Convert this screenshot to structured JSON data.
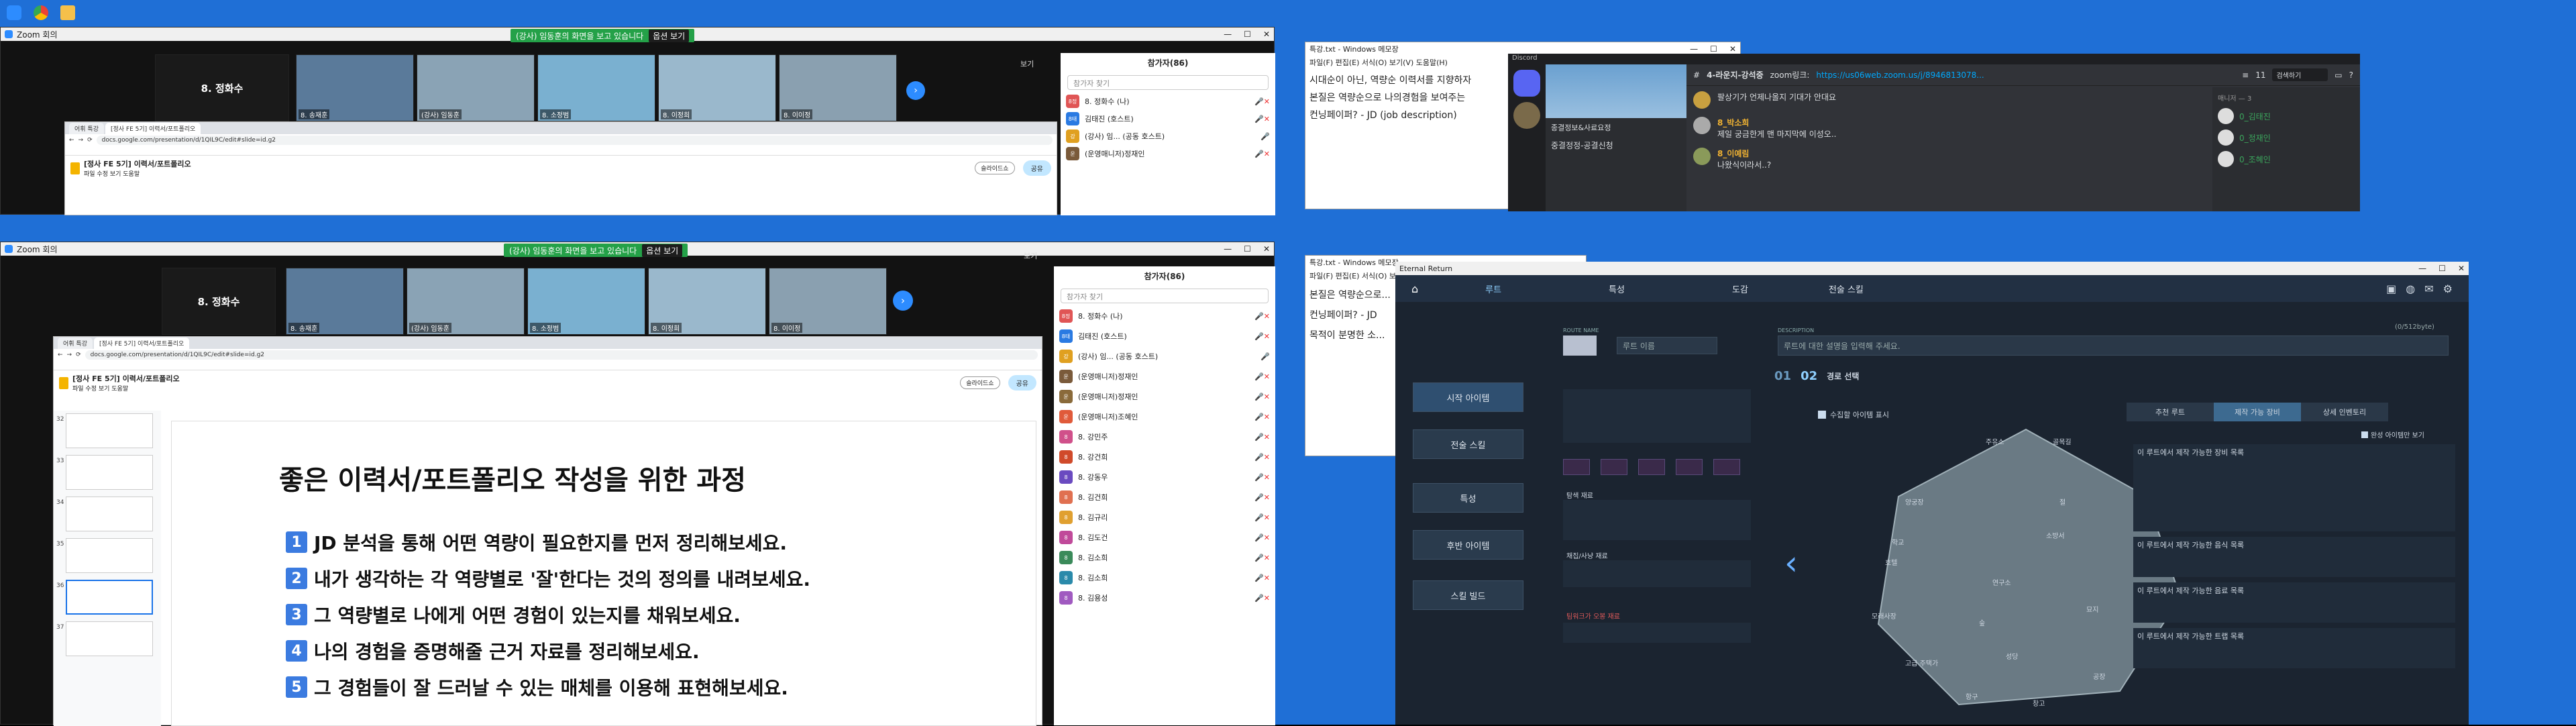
{
  "colors": {
    "zoom_green": "#24a148",
    "slides_blue": "#3b7be0",
    "desktop": "#1f6fd6"
  },
  "desktop_icons": [
    "zoom-icon",
    "chrome-icon",
    "folder-icon"
  ],
  "zoom_top": {
    "title": "Zoom 회의",
    "banner_text": "(강사) 임동훈의 화면을 보고 있습니다",
    "banner_button": "옵션 보기",
    "view_label": "보기",
    "speaker": "8. 정화수",
    "tiles": [
      "8. 송재훈",
      "(강사) 임동훈",
      "8. 소정범",
      "8. 이정희",
      "8. 이이정"
    ],
    "participants_header": "참가자(86)",
    "search_placeholder": "참가자 찾기",
    "participants": [
      {
        "badge": "8정",
        "name": "8. 정화수 (나)",
        "color": "#e05555"
      },
      {
        "badge": "8태",
        "name": "김태진 (호스트)",
        "color": "#2a7ae2"
      },
      {
        "badge": "강",
        "name": "(강사) 임... (공동 호스트)",
        "color": "#e0a020"
      },
      {
        "badge": "운",
        "name": "(운영매니저)정재인",
        "color": "#7a5a3a"
      }
    ]
  },
  "zoom_bottom": {
    "title": "Zoom 회의",
    "banner_text": "(강사) 임동훈의 화면을 보고 있습니다",
    "banner_button": "옵션 보기",
    "view_label": "보기",
    "speaker": "8. 정화수",
    "tiles": [
      "8. 송재훈",
      "(강사) 임동훈",
      "8. 소정범",
      "8. 이정희",
      "8. 이이정"
    ],
    "participants_header": "참가자(86)",
    "search_placeholder": "참가자 찾기",
    "participants": [
      {
        "badge": "8정",
        "name": "8. 정화수 (나)",
        "color": "#e05555"
      },
      {
        "badge": "8태",
        "name": "김태진 (호스트)",
        "color": "#2a7ae2"
      },
      {
        "badge": "강",
        "name": "(강사) 임... (공동 호스트)",
        "color": "#e0a020"
      },
      {
        "badge": "운",
        "name": "(운영매니저)정재인",
        "color": "#7a5a3a"
      },
      {
        "badge": "운",
        "name": "(운영매니저)정재인",
        "color": "#8a6a3a"
      },
      {
        "badge": "운",
        "name": "(운영매니저)조혜인",
        "color": "#e05a3a"
      },
      {
        "badge": "8",
        "name": "8. 강민주",
        "color": "#d0508a"
      },
      {
        "badge": "8",
        "name": "8. 강건희",
        "color": "#d04a2a"
      },
      {
        "badge": "8",
        "name": "8. 강동우",
        "color": "#6a4ac0"
      },
      {
        "badge": "8",
        "name": "8. 김건희",
        "color": "#e07050"
      },
      {
        "badge": "8",
        "name": "8. 김규리",
        "color": "#e0a030"
      },
      {
        "badge": "8",
        "name": "8. 김도건",
        "color": "#c04a9a"
      },
      {
        "badge": "8",
        "name": "8. 김소희",
        "color": "#3a8a5a"
      },
      {
        "badge": "8",
        "name": "8. 김소희",
        "color": "#2a8aaa"
      },
      {
        "badge": "8",
        "name": "8. 김용성",
        "color": "#a05ac0"
      }
    ]
  },
  "chrome_top": {
    "tab1": "어휘 특강",
    "tab2": "[정사 FE 5기] 이력서/포트폴리오",
    "url": "docs.google.com/presentation/d/1QIL9C/edit#slide=id.g2",
    "doc_title": "[정사 FE 5기] 이력서/포트폴리오",
    "menu": "파일  수정  보기  도움말",
    "share": "공유",
    "slideshow": "슬라이드쇼"
  },
  "chrome_bottom": {
    "tab1": "어휘 특강",
    "tab2": "[정사 FE 5기] 이력서/포트폴리오",
    "url": "docs.google.com/presentation/d/1QIL9C/edit#slide=id.g2",
    "doc_title": "[정사 FE 5기] 이력서/포트폴리오",
    "menu": "파일  수정  보기  도움말",
    "share": "공유",
    "slideshow": "슬라이드쇼",
    "thumb_numbers": [
      "32",
      "33",
      "34",
      "35",
      "36",
      "37"
    ]
  },
  "slide": {
    "title": "좋은 이력서/포트폴리오 작성을 위한 과정",
    "steps": [
      {
        "n": "1",
        "text": "JD 분석을 통해 어떤 역량이 필요한지를 먼저 정리해보세요."
      },
      {
        "n": "2",
        "text": "내가 생각하는 각 역량별로 '잘'한다는 것의 정의를 내려보세요."
      },
      {
        "n": "3",
        "text": "그 역량별로 나에게 어떤 경험이 있는지를 채워보세요."
      },
      {
        "n": "4",
        "text": "나의 경험을 증명해줄 근거 자료를 정리해보세요."
      },
      {
        "n": "5",
        "text": "그 경험들이 잘 드러날 수 있는 매체를 이용해 표현해보세요."
      }
    ]
  },
  "notepad_top": {
    "title": "특강.txt - Windows 메모장",
    "menu": "파일(F)  편집(E)  서식(O)  보기(V)  도움말(H)",
    "lines": [
      "시대순이 아닌, 역량순 이력서를 지향하자",
      "본질은 역량순으로 나의경험을 보여주는",
      "컨닝페이퍼? - JD (job description)"
    ]
  },
  "notepad_bottom": {
    "title": "특강.txt - Windows 메모장",
    "menu": "파일(F)  편집(E)  서식(O)  보기(V)  도움말(H)",
    "lines": [
      "본질은 역량순으로...",
      "컨닝페이퍼? - JD",
      "목적이 분명한 소..."
    ]
  },
  "discord": {
    "title": "Discord",
    "channel": "4-라운지-강석중",
    "server": "종결정보&사료요정",
    "channel_item": "중결정정-공결신청",
    "link_prefix": "zoom링크:",
    "link": "https://us06web.zoom.us/j/8946813078...",
    "member_count": "11",
    "search": "검색하기",
    "messages": [
      {
        "author": "",
        "text": "팔상기가 언제나올지 기대가 안대요"
      },
      {
        "author": "8_박소희",
        "text": "제일 궁금한게 맨 마지막에 이성오.."
      },
      {
        "author": "8_이예림",
        "text": "나왔식이라서..?"
      }
    ],
    "members_header": "매니저 — 3",
    "members": [
      "0_김태진",
      "0_정재인",
      "0_조혜인"
    ]
  },
  "game": {
    "title": "Eternal Return",
    "tabs": [
      "루트",
      "특성",
      "도감",
      "전술 스킬"
    ],
    "left_buttons": [
      "시작 아이템",
      "전술 스킬",
      "특성",
      "후반 아이템",
      "스킬 빌드"
    ],
    "route_name_label": "ROUTE NAME",
    "route_name_placeholder": "루트 이름",
    "description_label": "DESCRIPTION",
    "description_placeholder": "루트에 대한 설명을 입력해 주세요.",
    "char_counter": "(0/512byte)",
    "step1": "01",
    "step2": "02",
    "step2_label": "경로 선택",
    "collect_toggle": "수집할 아이템 표시",
    "right_tabs": [
      "추천 루트",
      "제작 가능 장비",
      "상세 인벤토리"
    ],
    "complete_toggle": "완성 아이템만 보기",
    "sections": [
      "이 루트에서 제작 가능한 장비 목록",
      "이 루트에서 제작 가능한 음식 목록",
      "이 루트에서 제작 가능한 음료 목록",
      "이 루트에서 제작 가능한 트랩 목록"
    ],
    "map_labels": [
      "주유소",
      "골목길",
      "양궁장",
      "절",
      "호텔",
      "모래사장",
      "연구소",
      "묘지",
      "숲",
      "고급 주택가",
      "성당",
      "학교",
      "공장",
      "소방서",
      "병원",
      "항구",
      "창고"
    ],
    "material_labels": [
      "탐색 재료",
      "채집/사냥 재료",
      "팀워크가 오봉 재료"
    ]
  }
}
